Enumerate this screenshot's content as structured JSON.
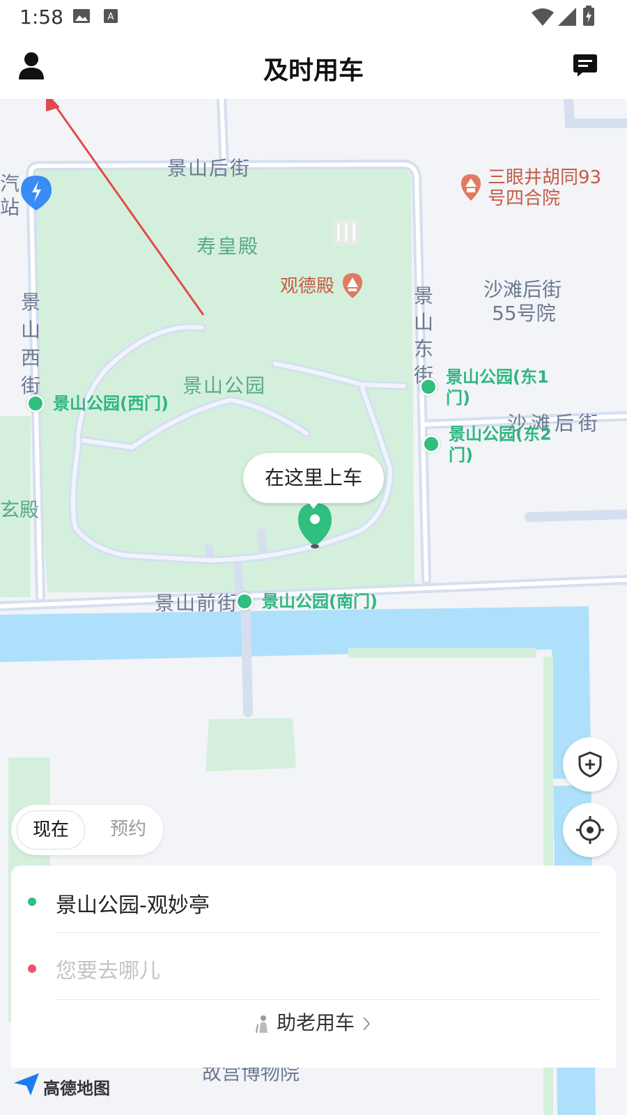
{
  "status_bar": {
    "time": "1:58"
  },
  "header": {
    "title": "及时用车"
  },
  "map": {
    "roads": {
      "jingshan_hou": "景山后街",
      "jingshan_xi": "景山西街",
      "jingshan_dong": "景山东街",
      "jingshan_qian": "景山前街",
      "shatan_hou": "沙滩后街",
      "qi_zhan_1": "汽",
      "qi_zhan_2": "站",
      "xuanxuan": "玄殿"
    },
    "places": {
      "shouhuangdian": "寿皇殿",
      "guandedian": "观德殿",
      "jingshan_park": "景山公园",
      "shatan_55_1": "沙滩后街",
      "shatan_55_2": "55号院",
      "gugong": "故宫博物院"
    },
    "poi_sanyanjing": {
      "line1": "三眼井胡同93",
      "line2": "号四合院"
    },
    "gates": {
      "west": "景山公园(西门)",
      "east1_line1": "景山公园(东1",
      "east1_line2": "门)",
      "east2_line1": "景山公园(东2",
      "east2_line2": "门)",
      "south": "景山公园(南门)"
    },
    "pickup_bubble": "在这里上车",
    "logo": "高德地图"
  },
  "time_toggle": {
    "now": "现在",
    "reserve": "预约",
    "selected": "现在"
  },
  "trip_card": {
    "origin": "景山公园-观妙亭",
    "destination_placeholder": "您要去哪儿",
    "elderly_mode": "助老用车"
  },
  "colors": {
    "accent_green": "#2fbf7f",
    "destination_red": "#f0506e",
    "park_green": "#d4f0dc",
    "water_blue": "#aee0fb",
    "road": "#d5dff0"
  },
  "icons": {
    "profile": "person-icon",
    "messages": "message-icon",
    "safety": "shield-plus-icon",
    "locate": "crosshair-icon",
    "elderly": "elderly-person-icon",
    "chevron": "chevron-right-icon"
  }
}
